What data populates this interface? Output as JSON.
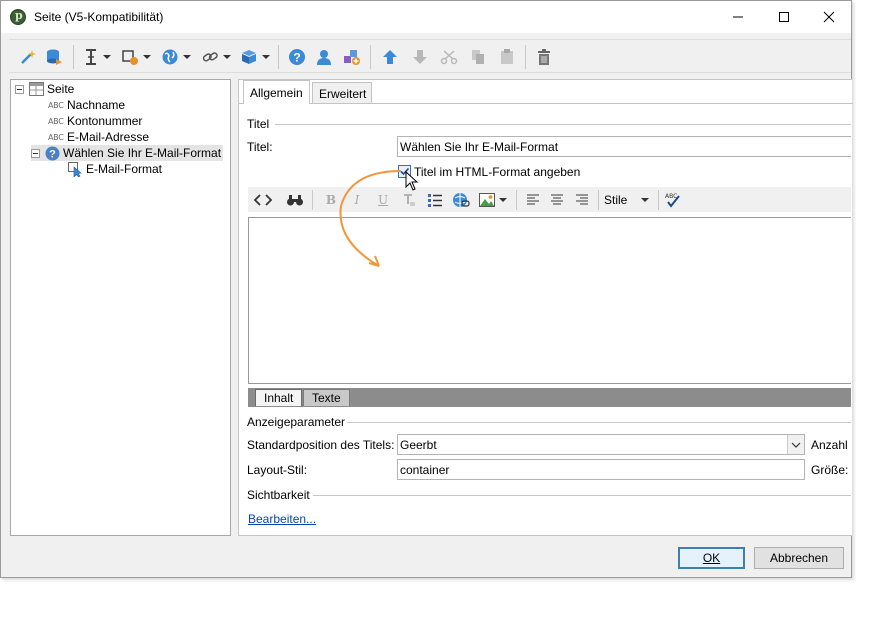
{
  "window": {
    "title": "Seite (V5-Kompatibilität)"
  },
  "toolbar": {
    "icons": [
      "wizard-icon",
      "database-icon",
      "text-cursor-icon",
      "form-field-icon",
      "globe-icon",
      "link-icon",
      "package-icon",
      "help-icon",
      "user-icon",
      "add-component-icon",
      "arrow-up-icon",
      "arrow-down-icon",
      "cut-icon",
      "copy-icon",
      "paste-icon",
      "delete-icon"
    ]
  },
  "tree": {
    "abc_prefix": "ABC",
    "root": "Seite",
    "items": [
      "Nachname",
      "Kontonummer",
      "E-Mail-Adresse",
      "Wählen Sie Ihr E-Mail-Format"
    ],
    "child": "E-Mail-Format"
  },
  "tabs": [
    "Allgemein",
    "Erweitert"
  ],
  "titel_group": {
    "heading": "Titel",
    "label": "Titel:",
    "value": "Wählen Sie Ihr E-Mail-Format",
    "checkbox_label": "Titel im HTML-Format angeben",
    "checked": true
  },
  "editor": {
    "styles_label": "Stile",
    "spell_label": "ABC"
  },
  "bottom_tabs": [
    "Inhalt",
    "Texte"
  ],
  "display": {
    "heading": "Anzeigeparameter",
    "position_label": "Standardposition des Titels:",
    "position_value": "Geerbt",
    "count_label": "Anzahl",
    "layout_label": "Layout-Stil:",
    "layout_value": "container",
    "size_label": "Größe:"
  },
  "visibility": {
    "heading": "Sichtbarkeit",
    "edit_link": "Bearbeiten..."
  },
  "buttons": {
    "ok": "OK",
    "cancel": "Abbrechen"
  },
  "colors": {
    "accent": "#f0963c",
    "link": "#0645ad",
    "arrow_blue": "#3a8ad6"
  }
}
